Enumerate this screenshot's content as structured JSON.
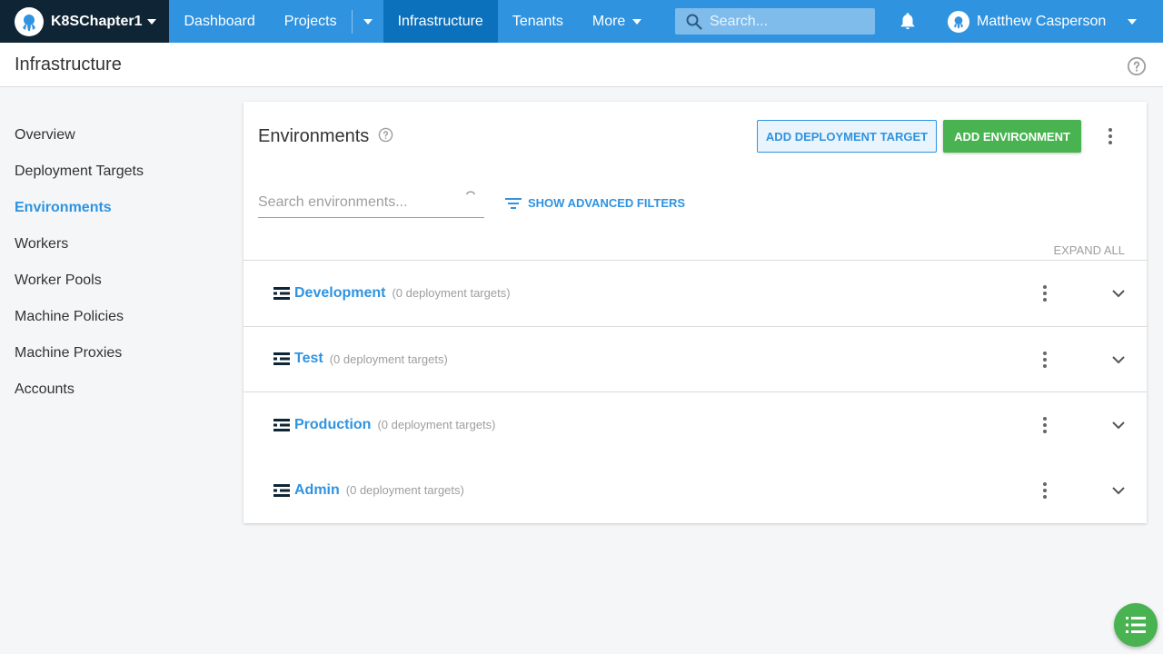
{
  "topnav": {
    "space_name": "K8SChapter1",
    "items": {
      "dashboard": "Dashboard",
      "projects": "Projects",
      "infrastructure": "Infrastructure",
      "tenants": "Tenants",
      "more": "More"
    },
    "search_placeholder": "Search...",
    "user_name": "Matthew Casperson"
  },
  "page": {
    "title": "Infrastructure"
  },
  "sidebar": {
    "items": [
      "Overview",
      "Deployment Targets",
      "Environments",
      "Workers",
      "Worker Pools",
      "Machine Policies",
      "Machine Proxies",
      "Accounts"
    ],
    "active": "Environments"
  },
  "panel": {
    "title": "Environments",
    "add_target_label": "ADD DEPLOYMENT TARGET",
    "add_env_label": "ADD ENVIRONMENT",
    "search_placeholder": "Search environments...",
    "filter_label": "SHOW ADVANCED FILTERS",
    "expand_all_label": "EXPAND ALL"
  },
  "environments": [
    {
      "name": "Development",
      "count": "(0 deployment targets)"
    },
    {
      "name": "Test",
      "count": "(0 deployment targets)"
    },
    {
      "name": "Production",
      "count": "(0 deployment targets)"
    },
    {
      "name": "Admin",
      "count": "(0 deployment targets)"
    }
  ],
  "icons": {
    "space_logo": "octopus-logo-icon",
    "search": "search-icon",
    "notifications": "bell-icon",
    "user": "user-avatar-icon",
    "help": "help-circle-icon",
    "menu": "kebab-menu-icon",
    "filter": "filter-icon",
    "environment": "environment-icon",
    "expand": "chevron-down-icon",
    "fab": "task-list-icon"
  },
  "colors": {
    "primary": "#2f93e0",
    "nav_active": "#0c71bd",
    "space_bg": "#0f2535",
    "success": "#48b350"
  }
}
